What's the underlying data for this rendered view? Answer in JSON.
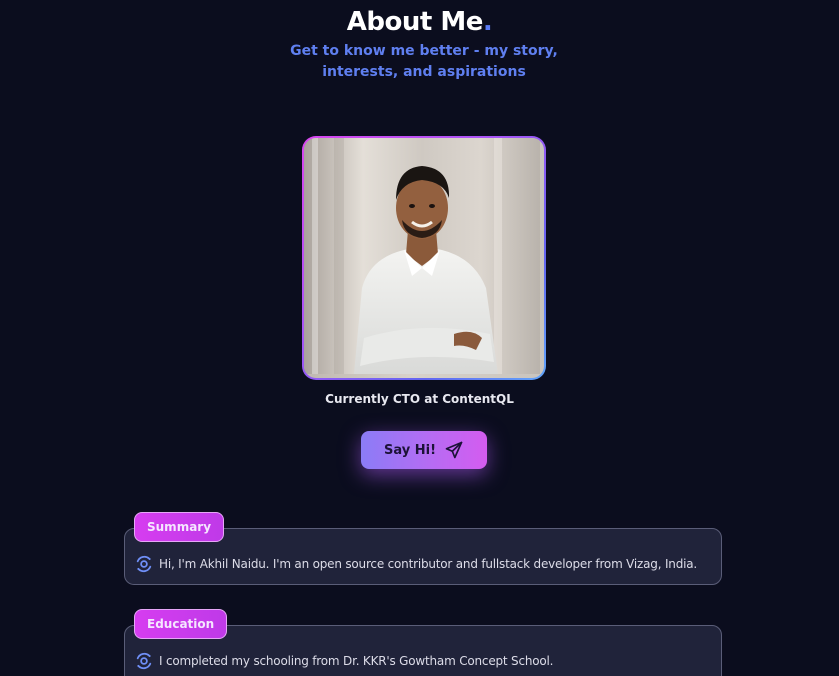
{
  "header": {
    "title": "About Me",
    "title_dot": ".",
    "subtitle": "Get to know me better - my story, interests, and aspirations"
  },
  "profile": {
    "caption": "Currently CTO at ContentQL"
  },
  "cta": {
    "label": "Say Hi!",
    "icon": "send-icon"
  },
  "sections": {
    "summary": {
      "label": "Summary",
      "icon": "orbit-icon",
      "text": "Hi, I'm Akhil Naidu. I'm an open source contributor and fullstack developer from Vizag, India."
    },
    "education": {
      "label": "Education",
      "icon": "orbit-icon",
      "text": "I completed my schooling from Dr. KKR's Gowtham Concept School."
    }
  },
  "colors": {
    "background": "#0b0d1e",
    "accent_blue": "#5f7ff0",
    "accent_magenta": "#d63df0",
    "card": "#20233a"
  }
}
